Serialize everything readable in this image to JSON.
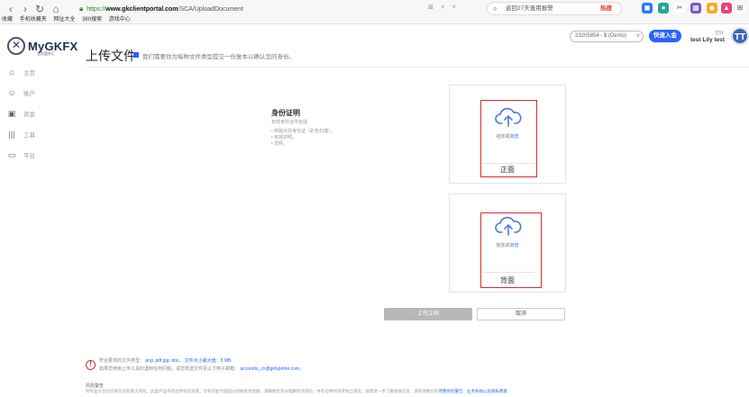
{
  "browser": {
    "url_scheme": "https://",
    "url_host": "www.gkclientportal.com",
    "url_path": "/SCA/UploadDocument",
    "search_text": "返回27天查用报警",
    "search_hot": "热搜",
    "bookmarks": [
      "收藏",
      "手机收藏夹",
      "网址大全",
      "360搜索",
      "游戏中心"
    ]
  },
  "app": {
    "logo_text": "MyGKFX",
    "logo_sub": "金凯富外汇",
    "account_pill": "23205854 - $ (Demo)",
    "deposit_button": "快速入金",
    "user_hello": "您好",
    "user_name": "test Lily test",
    "avatar_initials": "TT"
  },
  "sidebar": {
    "items": [
      {
        "label": "主页",
        "icon": "home-icon"
      },
      {
        "label": "账户",
        "icon": "user-icon"
      },
      {
        "label": "资金",
        "icon": "wallet-icon"
      },
      {
        "label": "工具",
        "icon": "tools-icon"
      },
      {
        "label": "平台",
        "icon": "platform-icon"
      }
    ]
  },
  "page": {
    "title": "上传文件",
    "description": "我们需要你为每种文件类型提交一份复本以确认您的身份。"
  },
  "id_proof": {
    "title": "身份证明",
    "subtitle": "有效身份证件包括",
    "items": [
      "新版片的身份证（彩色扫描）。",
      "有效护照。",
      "驾照。"
    ]
  },
  "upload": {
    "front": {
      "hint_text": "拖放或",
      "hint_link": "浏览",
      "label": "正面"
    },
    "back": {
      "hint_text": "拖放或",
      "hint_link": "浏览",
      "label": "背面"
    }
  },
  "actions": {
    "upload_label": "上传文档",
    "cancel_label": "取消"
  },
  "footer": {
    "line1_text": "符合要求的文件类型：",
    "line1_types": "png .pdf.jpg .doc。",
    "line1_size": "文件大小最大值：5 MB",
    "line2_text": "如果您使用上传工具时遇到任何问题，请您发送文件至以下电子邮箱：",
    "line2_email": "accounts_cn@gkfxprime.com。",
    "risk_title": "风险警告",
    "risk_body": "所有差价合约交易均涉及重大风险。此类产品不适合所有投资者，您有可能亏损超过初始投资金额。请确保您充分理解所涉风险，并在必要时寻求独立意见。如需进一步了解相关信息，请参阅我们的",
    "risk_link1": "完整风险警告",
    "risk_link2": "业务条款",
    "risk_link3": "以及隐私政策"
  },
  "colors": {
    "accent": "#2962ff",
    "highlight_frame": "#d32f2f",
    "disabled_button": "#b8b8b8"
  }
}
